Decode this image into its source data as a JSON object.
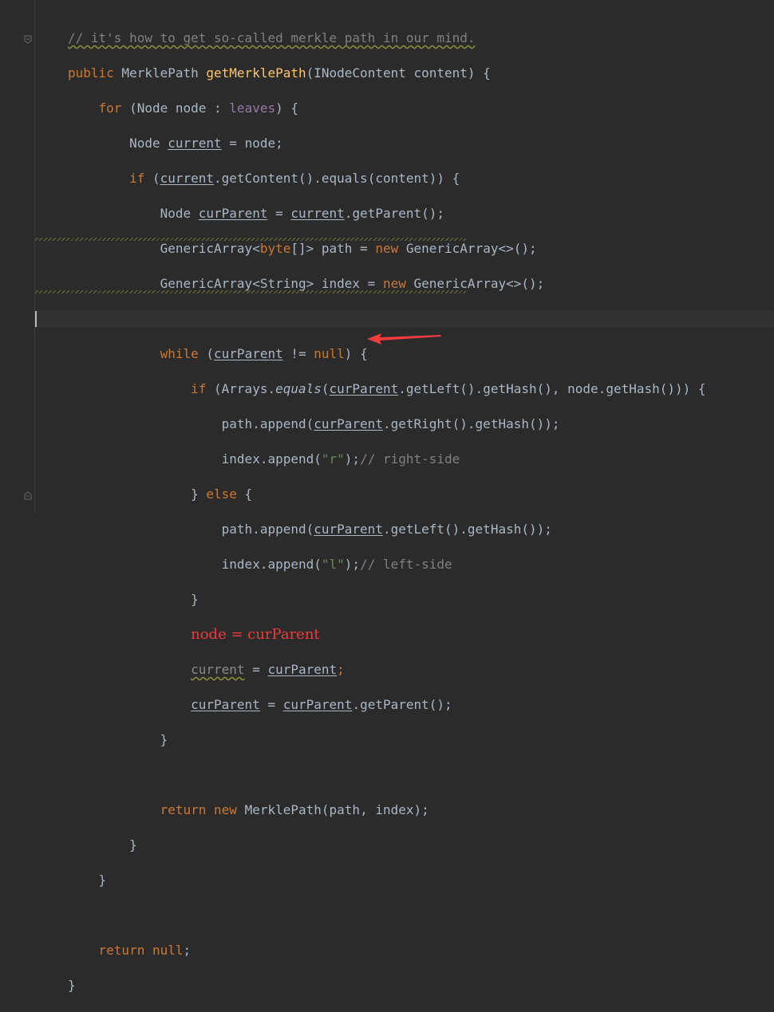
{
  "editor": {
    "annotation": "node = curParent",
    "tokens": {
      "l1": "// it's how to get so-called merkle path in our mind.",
      "l2a": "public",
      "l2b": " MerklePath ",
      "l2c": "getMerklePath",
      "l2d": "(INodeContent content) {",
      "l3a": "for",
      "l3b": " (Node node : ",
      "l3c": "leaves",
      "l3d": ") {",
      "l4a": "Node ",
      "l4b": "current",
      "l4c": " = node;",
      "l5a": "if",
      "l5b": " (",
      "l5c": "current",
      "l5d": ".getContent().equals(content)) {",
      "l6a": "Node ",
      "l6b": "curParent",
      "l6c": " = ",
      "l6d": "current",
      "l6e": ".getParent();",
      "l7a": "GenericArray<",
      "l7b": "byte",
      "l7c": "[]> path = ",
      "l7d": "new",
      "l7e": " GenericArray<>();",
      "l8a": "GenericArray<String> index = ",
      "l8b": "new",
      "l8c": " GenericArray<>();",
      "l10a": "while",
      "l10b": " (",
      "l10c": "curParent",
      "l10d": " != ",
      "l10e": "null",
      "l10f": ") {",
      "l11a": "if",
      "l11b": " (Arrays.",
      "l11c": "equals",
      "l11d": "(",
      "l11e": "curParent",
      "l11f": ".getLeft().getHash(), node.getHash())) {",
      "l12a": "path.append(",
      "l12b": "curParent",
      "l12c": ".getRight().getHash());",
      "l13a": "index.append(",
      "l13b": "\"r\"",
      "l13c": ");",
      "l13d": "// right-side",
      "l14a": "} ",
      "l14b": "else",
      "l14c": " {",
      "l15a": "path.append(",
      "l15b": "curParent",
      "l15c": ".getLeft().getHash());",
      "l16a": "index.append(",
      "l16b": "\"l\"",
      "l16c": ");",
      "l16d": "// left-side",
      "l17": "}",
      "l19a": "current",
      "l19b": " = ",
      "l19c": "curParent",
      "l19d": ";",
      "l20a": "curParent",
      "l20b": " = ",
      "l20c": "curParent",
      "l20d": ".getParent();",
      "l21": "}",
      "l23a": "return",
      "l23b": " ",
      "l23c": "new",
      "l23d": " MerklePath(path, index);",
      "l24": "}",
      "l25": "}",
      "l27a": "return",
      "l27b": " ",
      "l27c": "null",
      "l27d": ";",
      "l28": "}"
    }
  },
  "colors": {
    "background": "#2b2b2b",
    "keyword": "#cc7832",
    "method": "#ffc66d",
    "field": "#9876aa",
    "string": "#6a8759",
    "comment": "#808080",
    "annotation": "#f03c3c"
  },
  "icons": {
    "fold_top": "fold-open-icon",
    "fold_bottom": "fold-close-icon",
    "arrow": "red-arrow-icon"
  }
}
